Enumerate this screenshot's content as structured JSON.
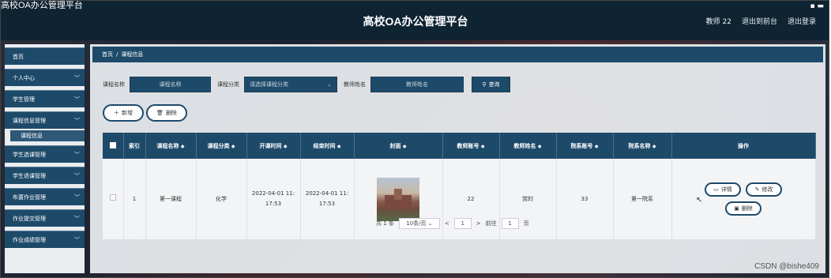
{
  "window": {
    "title": "高校OA办公管理平台",
    "controls": "▪ ▬"
  },
  "header": {
    "title": "高校OA办公管理平台",
    "nav": [
      "教师 22",
      "退出到前台",
      "退出登录"
    ]
  },
  "sidebar": {
    "items": [
      {
        "label": "首页",
        "has_chevron": false
      },
      {
        "label": "个人中心",
        "has_chevron": true
      },
      {
        "label": "学生管理",
        "has_chevron": true
      },
      {
        "label": "课程信息管理",
        "has_chevron": true
      },
      {
        "label": "学生选课管理",
        "has_chevron": true
      },
      {
        "label": "学生退课管理",
        "has_chevron": true
      },
      {
        "label": "布置作业管理",
        "has_chevron": true
      },
      {
        "label": "作业提交管理",
        "has_chevron": true
      },
      {
        "label": "作业成绩管理",
        "has_chevron": true
      }
    ],
    "sub_item": "课程信息"
  },
  "breadcrumb": {
    "home": "首页",
    "sep": "/",
    "current": "课程信息"
  },
  "filters": {
    "course_name_label": "课程名称",
    "course_name_placeholder": "课程名称",
    "category_label": "课程分类",
    "category_placeholder": "请选择课程分类",
    "teacher_label": "教师姓名",
    "teacher_placeholder": "教师姓名",
    "query_button": "查询"
  },
  "actions": {
    "add": "新增",
    "delete": "删除"
  },
  "table": {
    "columns": [
      "索引",
      "课程名称",
      "课程分类",
      "开课时间",
      "结束时间",
      "封面",
      "教师账号",
      "教师姓名",
      "院系账号",
      "院系名称",
      "操作"
    ],
    "rows": [
      {
        "index": "1",
        "course_name": "第一课程",
        "category": "化学",
        "start_line1": "2022-04-01 11:",
        "start_line2": "17:53",
        "end_line1": "2022-04-01 11:",
        "end_line2": "17:53",
        "teacher_account": "22",
        "teacher_name": "赏的",
        "dept_account": "33",
        "dept_name": "第一院系"
      }
    ],
    "row_actions": {
      "detail": "详情",
      "edit": "修改",
      "delete": "删除"
    }
  },
  "pager": {
    "total": "共 1 条",
    "page_size": "10条/页",
    "prev": "<",
    "page": "1",
    "next": ">",
    "goto_label": "前往",
    "goto_value": "1",
    "goto_suffix": "页"
  },
  "watermark": "CSDN @bishe409",
  "colors": {
    "primary": "#1e4a6a",
    "header": "#0f2433"
  }
}
